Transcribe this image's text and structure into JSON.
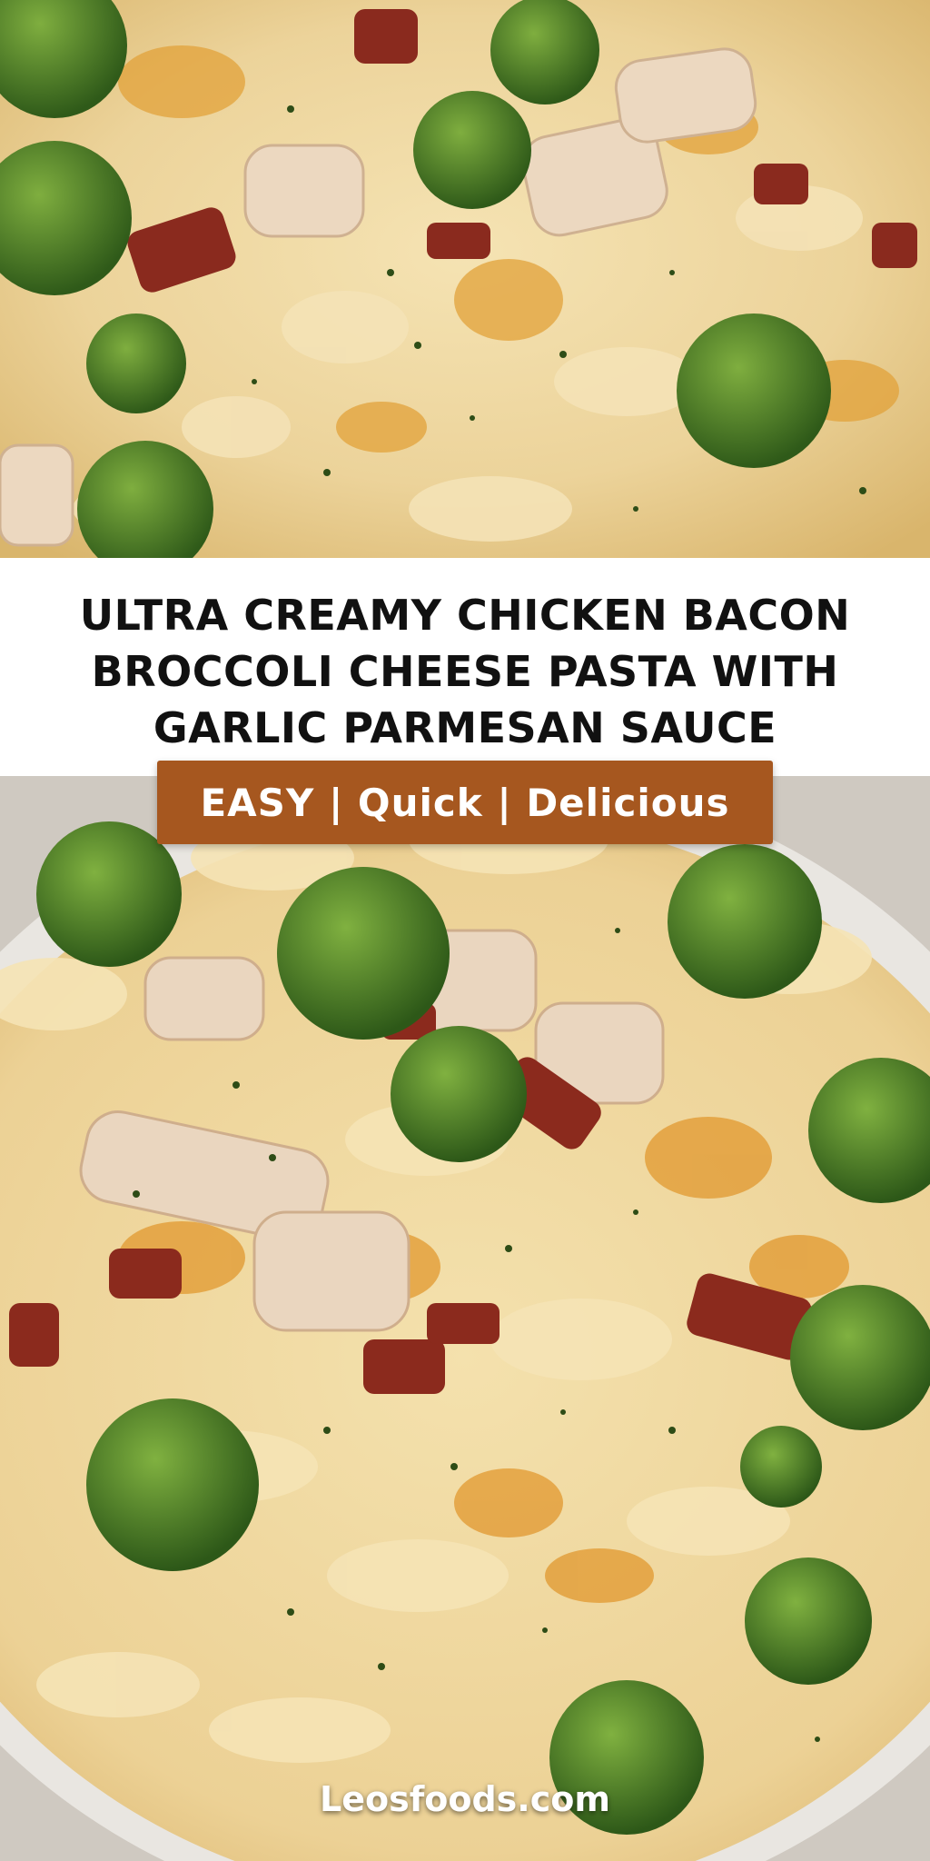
{
  "title": "ULTRA CREAMY CHICKEN BACON BROCCOLI CHEESE PASTA WITH GARLIC PARMESAN SAUCE",
  "tagline": "EASY | Quick | Delicious",
  "watermark": "Leosfoods.com",
  "colors": {
    "title_text": "#111111",
    "badge_background": "#a6571f",
    "badge_text": "#ffffff",
    "cheese_sauce": "#efd9a2",
    "broccoli": "#3f6e24",
    "bacon": "#8a2a1e",
    "chicken": "#ead6bf"
  }
}
